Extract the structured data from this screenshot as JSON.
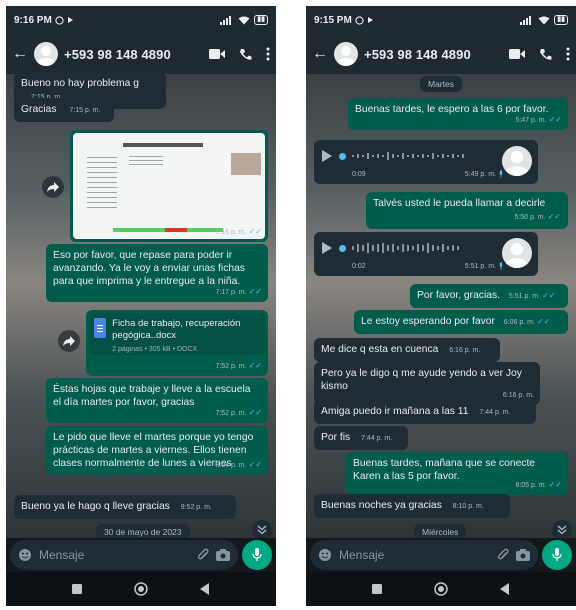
{
  "left_screen": {
    "status": {
      "time": "9:16 PM"
    },
    "header": {
      "contact": "+593 98 148 4890"
    },
    "messages": {
      "m1": {
        "text": "Bueno no hay problema g",
        "time": "7:15 p. m."
      },
      "m2": {
        "text": "Gracias",
        "time": "7:15 p. m."
      },
      "img": {
        "time": "7:16 p. m."
      },
      "m3": {
        "text": "Eso por favor, que repase para poder ir avanzando. Ya le voy a enviar unas fichas para que imprima y le entregue a la niña.",
        "time": "7:17 p. m."
      },
      "doc": {
        "name": "Ficha de trabajo, recuperación pegógica..docx",
        "info": "2 páginas • 305 kB • DOCX",
        "time": "7:52 p. m."
      },
      "m4": {
        "text": "Éstas hojas que trabaje y lleve a la escuela el día martes por favor, gracias",
        "time": "7:52 p. m."
      },
      "m5": {
        "text": "Le pido que lleve el martes porque yo tengo prácticas de martes a viernes. Ellos tienen clases normalmente de lunes a viernes",
        "time": "8:04 p. m."
      },
      "m6": {
        "text": "Bueno ya le hago q lleve gracias",
        "time": "9:52 p. m."
      }
    },
    "date_chip": "30 de mayo de 2023",
    "composer": {
      "placeholder": "Mensaje"
    }
  },
  "right_screen": {
    "status": {
      "time": "9:15 PM"
    },
    "header": {
      "contact": "+593 98 148 4890"
    },
    "date_chip_top": "Martes",
    "messages": {
      "r1": {
        "text": "Buenas tardes, le espero a las 6 por favor.",
        "time": "5:47 p. m."
      },
      "v1": {
        "duration": "0:09",
        "time": "5:49 p. m."
      },
      "r2": {
        "text": "Talvés usted le pueda llamar a decirle",
        "time": "5:50 p. m."
      },
      "v2": {
        "duration": "0:02",
        "time": "5:51 p. m."
      },
      "r3": {
        "text": "Por favor, gracias.",
        "time": "5:51 p. m."
      },
      "r4": {
        "text": "Le estoy esperando por favor",
        "time": "6:06 p. m."
      },
      "r5": {
        "text": "Me dice q esta en cuenca",
        "time": "6:16 p. m."
      },
      "r6": {
        "text": "Pero ya le digo q me ayude yendo a ver Joy kismo",
        "time": "6:16 p. m."
      },
      "r7": {
        "text": "Amiga puedo ir mañana a las 11",
        "time": "7:44 p. m."
      },
      "r8": {
        "text": "Por fis",
        "time": "7:44 p. m."
      },
      "r9": {
        "text": "Buenas tardes, mañana que se conecte Karen a las 5 por favor.",
        "time": "8:05 p. m."
      },
      "r10": {
        "text": "Buenas noches ya gracias",
        "time": "8:10 p. m."
      }
    },
    "date_chip_bottom": "Miércoles",
    "composer": {
      "placeholder": "Mensaje"
    }
  },
  "colors": {
    "header_bg": "#1e2a30",
    "incoming_bubble": "#1f2c33",
    "outgoing_bubble": "#005c4b",
    "accent_green": "#00a884",
    "read_ticks": "#53bdeb"
  }
}
